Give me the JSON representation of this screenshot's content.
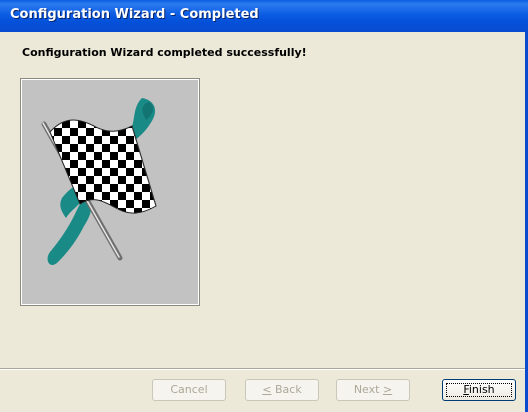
{
  "window": {
    "title": "Configuration Wizard - Completed"
  },
  "content": {
    "heading": "Configuration Wizard completed successfully!"
  },
  "buttons": {
    "cancel": "Cancel",
    "back_prefix": "",
    "back_underlined": "<",
    "back_label": " Back",
    "next_label": "Next ",
    "next_underlined": ">",
    "finish_underlined": "F",
    "finish_rest": "inish"
  },
  "colors": {
    "titlebar": "#0c5ce4",
    "dialog_bg": "#ece9d8",
    "image_bg": "#c2c2c2",
    "brush_teal": "#1a8a86"
  },
  "image": {
    "icon": "checkered-flag-icon"
  }
}
